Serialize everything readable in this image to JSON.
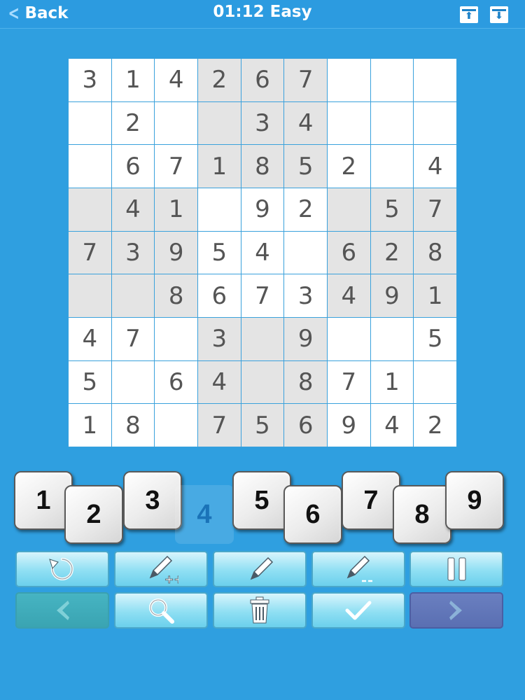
{
  "header": {
    "back_label": "Back",
    "title": "01:12 Easy",
    "icons": [
      "upload-icon",
      "download-icon"
    ]
  },
  "board": {
    "rows": [
      [
        "3",
        "1",
        "4",
        "2",
        "6",
        "7",
        "",
        "",
        ""
      ],
      [
        "",
        "2",
        "",
        "",
        "3",
        "4",
        "",
        "",
        ""
      ],
      [
        "",
        "6",
        "7",
        "1",
        "8",
        "5",
        "2",
        "",
        "4"
      ],
      [
        "",
        "4",
        "1",
        "",
        "9",
        "2",
        "",
        "5",
        "7"
      ],
      [
        "7",
        "3",
        "9",
        "5",
        "4",
        "",
        "6",
        "2",
        "8"
      ],
      [
        "",
        "",
        "8",
        "6",
        "7",
        "3",
        "4",
        "9",
        "1"
      ],
      [
        "4",
        "7",
        "",
        "3",
        "",
        "9",
        "",
        "",
        "5"
      ],
      [
        "5",
        "",
        "6",
        "4",
        "",
        "8",
        "7",
        "1",
        ""
      ],
      [
        "1",
        "8",
        "",
        "7",
        "5",
        "6",
        "9",
        "4",
        "2"
      ]
    ]
  },
  "number_pad": [
    "1",
    "2",
    "3",
    "4",
    "5",
    "6",
    "7",
    "8",
    "9"
  ],
  "tools": {
    "row1": [
      "undo-icon",
      "pencil-plus-icon",
      "pencil-icon",
      "pencil-minus-icon",
      "pause-icon"
    ],
    "row2": [
      "arrow-left-icon",
      "magnifier-icon",
      "trash-icon",
      "check-icon",
      "arrow-right-icon"
    ]
  },
  "colors": {
    "background": "#2f9fe0",
    "grid_line": "#3aa1dc",
    "shaded_cell": "#e4e4e4",
    "tool_button": "#8fdff3"
  }
}
